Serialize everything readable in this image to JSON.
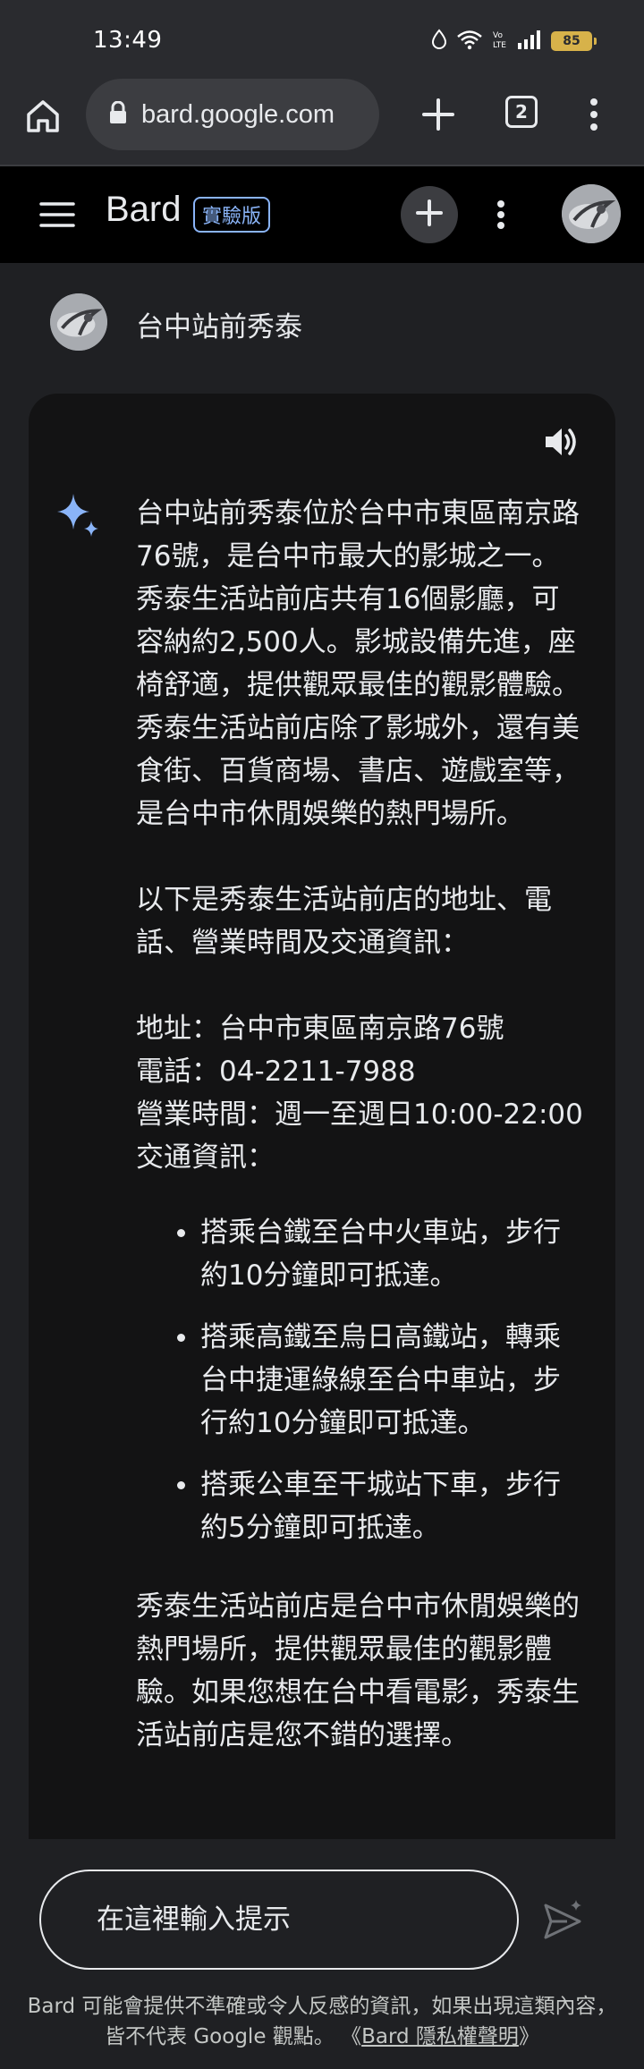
{
  "status_bar": {
    "time": "13:49",
    "battery": "85",
    "icons": [
      "alarm-icon",
      "wifi-icon",
      "volte-icon",
      "signal-icon",
      "battery-icon"
    ]
  },
  "browser": {
    "url": "bard.google.com",
    "tab_count": "2",
    "icons": [
      "home-icon",
      "lock-icon",
      "plus-icon",
      "tab-switcher-icon",
      "more-vert-icon"
    ]
  },
  "header": {
    "brand": "Bard",
    "badge": "實驗版",
    "icons": [
      "hamburger-icon",
      "plus-icon",
      "more-vert-icon",
      "avatar"
    ]
  },
  "conversation": {
    "user_prompt": "台中站前秀泰",
    "response": {
      "intro": "台中站前秀泰位於台中市東區南京路76號，是台中市最大的影城之一。秀泰生活站前店共有16個影廳，可容納約2,500人。影城設備先進，座椅舒適，提供觀眾最佳的觀影體驗。秀泰生活站前店除了影城外，還有美食街、百貨商場、書店、遊戲室等，是台中市休閒娛樂的熱門場所。",
      "lead": "以下是秀泰生活站前店的地址、電話、營業時間及交通資訊：",
      "address": "地址：台中市東區南京路76號",
      "phone": "電話：04-2211-7988",
      "hours": "營業時間：週一至週日10:00-22:00",
      "transport_label": "交通資訊：",
      "transport": [
        "搭乘台鐵至台中火車站，步行約10分鐘即可抵達。",
        "搭乘高鐵至烏日高鐵站，轉乘台中捷運綠線至台中車站，步行約10分鐘即可抵達。",
        "搭乘公車至干城站下車，步行約5分鐘即可抵達。"
      ],
      "closing": "秀泰生活站前店是台中市休閒娛樂的熱門場所，提供觀眾最佳的觀影體驗。如果您想在台中看電影，秀泰生活站前店是您不錯的選擇。"
    }
  },
  "input": {
    "placeholder": "在這裡輸入提示"
  },
  "disclaimer": {
    "text": "Bard 可能會提供不準確或令人反感的資訊，如果出現這類內容，皆不代表 Google 觀點。",
    "link_open": "《",
    "link": "Bard 隱私權聲明",
    "link_close": "》"
  },
  "colors": {
    "page_bg": "#1f2023",
    "card_bg": "#131314",
    "header_bg": "#000000",
    "accent": "#8ab4f8",
    "battery": "#d7b24a"
  }
}
